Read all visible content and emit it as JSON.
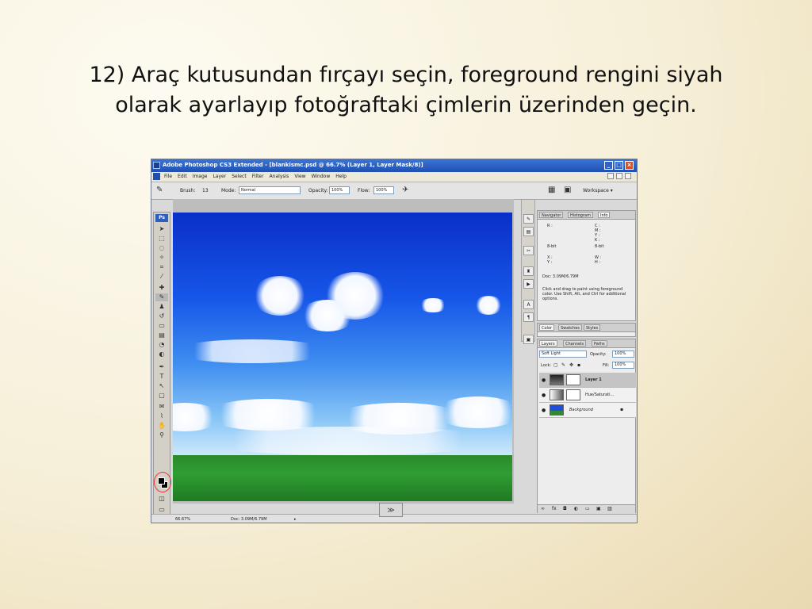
{
  "slide": {
    "title_line1": "12) Araç kutusundan fırçayı seçin, foreground rengini siyah",
    "title_line2": "olarak ayarlayıp fotoğraftaki çimlerin üzerinden geçin."
  },
  "window": {
    "title": "Adobe Photoshop CS3 Extended - [blankismc.psd @ 66.7% (Layer 1, Layer Mask/8)]",
    "min_glyph": "_",
    "max_glyph": "□",
    "close_glyph": "×"
  },
  "menubar": {
    "items": [
      "File",
      "Edit",
      "Image",
      "Layer",
      "Select",
      "Filter",
      "Analysis",
      "View",
      "Window",
      "Help"
    ]
  },
  "options_bar": {
    "brush_label": "Brush:",
    "brush_size": "13",
    "mode_label": "Mode:",
    "mode_value": "Normal",
    "opacity_label": "Opacity:",
    "opacity_value": "100%",
    "flow_label": "Flow:",
    "flow_value": "100%",
    "workspace_label": "Workspace ▾"
  },
  "toolbox": {
    "logo": "Ps"
  },
  "status_bar": {
    "zoom": "66.67%",
    "doc": "Doc: 3.09M/6.79M"
  },
  "info_panel": {
    "tabs": [
      "Navigator",
      "Histogram",
      "Info"
    ],
    "r_label": "R :",
    "c_label": "C :",
    "m_label": "M :",
    "y_label": "Y :",
    "k_label": "K :",
    "bit_left": "8-bit",
    "bit_right": "8-bit",
    "x_label": "X :",
    "y2_label": "Y :",
    "w_label": "W :",
    "h_label": "H :",
    "doc": "Doc: 3.09M/6.79M",
    "hint": "Click and drag to paint using foreground color. Use Shift, Alt, and Ctrl for additional options."
  },
  "color_panel": {
    "tabs": [
      "Color",
      "Swatches",
      "Styles"
    ]
  },
  "layers_panel": {
    "tabs": [
      "Layers",
      "Channels",
      "Paths"
    ],
    "blend_mode": "Soft Light",
    "opacity_label": "Opacity:",
    "opacity_value": "100%",
    "lock_label": "Lock:",
    "fill_label": "Fill:",
    "fill_value": "100%",
    "layers": [
      {
        "name": "Layer 1",
        "selected": true
      },
      {
        "name": "Hue/Saturati...",
        "selected": false
      },
      {
        "name": "Background",
        "selected": false
      }
    ]
  },
  "icons": {
    "eye": "●",
    "lock": "🔒",
    "expand": "≫"
  }
}
